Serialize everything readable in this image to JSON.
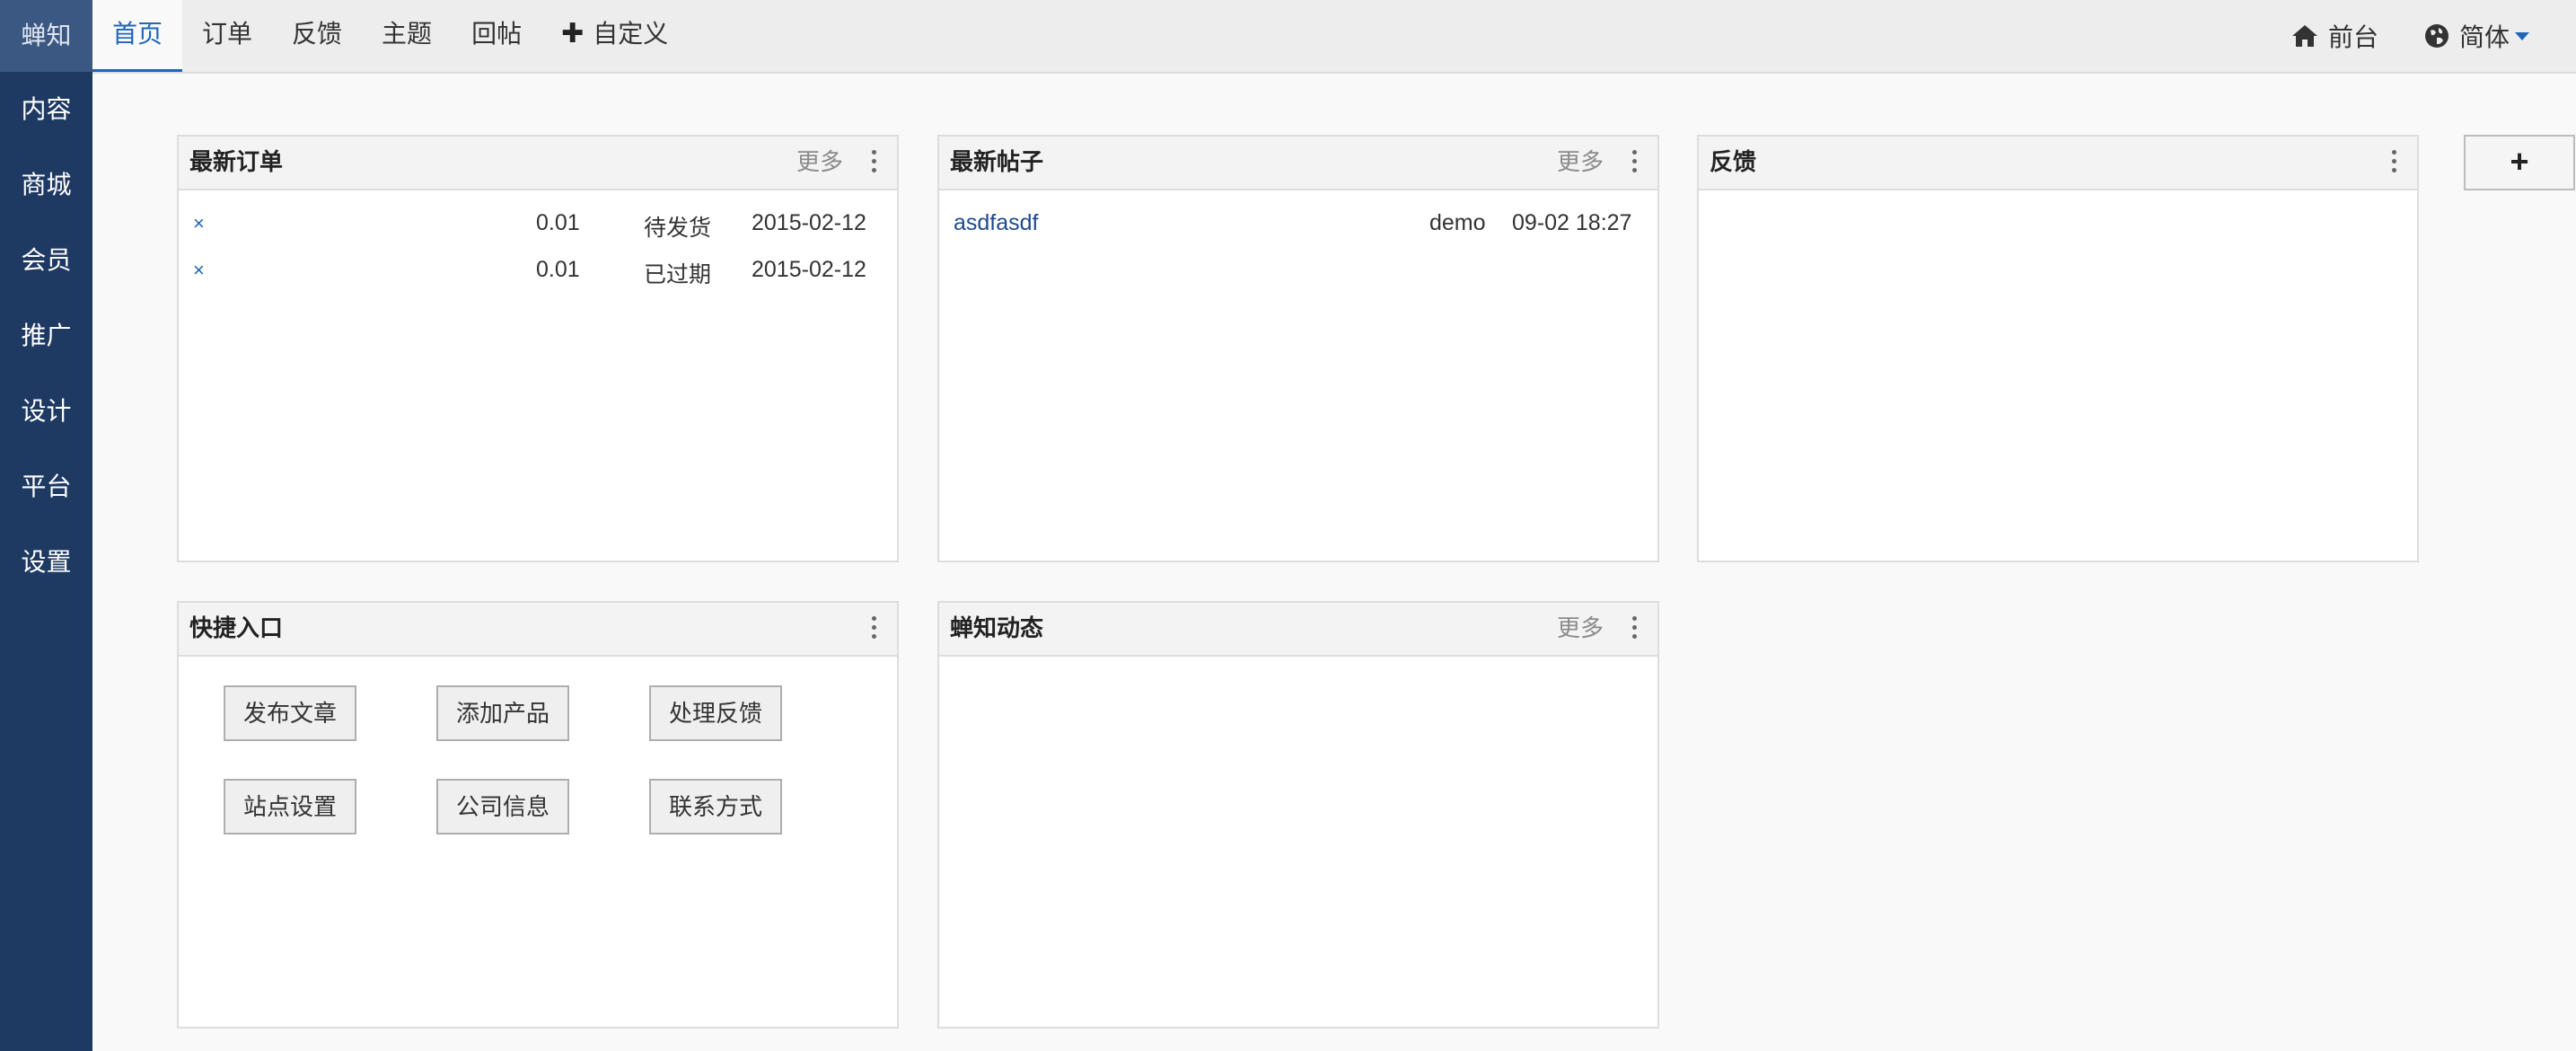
{
  "sidebar": {
    "brand": "蝉知",
    "items": [
      "内容",
      "商城",
      "会员",
      "推广",
      "设计",
      "平台",
      "设置"
    ]
  },
  "topnav": {
    "tabs": [
      "首页",
      "订单",
      "反馈",
      "主题",
      "回帖"
    ],
    "custom": "自定义",
    "frontend": "前台",
    "language": "简体"
  },
  "panels": {
    "orders": {
      "title": "最新订单",
      "more": "更多",
      "rows": [
        {
          "remove": "×",
          "amount": "0.01",
          "status": "待发货",
          "date": "2015-02-12"
        },
        {
          "remove": "×",
          "amount": "0.01",
          "status": "已过期",
          "date": "2015-02-12"
        }
      ]
    },
    "posts": {
      "title": "最新帖子",
      "more": "更多",
      "rows": [
        {
          "title": "asdfasdf",
          "author": "demo",
          "time": "09-02 18:27"
        }
      ]
    },
    "feedback": {
      "title": "反馈"
    },
    "shortcuts": {
      "title": "快捷入口",
      "buttons": [
        "发布文章",
        "添加产品",
        "处理反馈",
        "站点设置",
        "公司信息",
        "联系方式"
      ]
    },
    "news": {
      "title": "蝉知动态",
      "more": "更多"
    }
  },
  "add_widget": "+",
  "colors": {
    "sidebar": "#1e3a63",
    "brand_bg": "#3b5882",
    "accent": "#1f66b8",
    "page_bg": "#f9f9f9"
  }
}
